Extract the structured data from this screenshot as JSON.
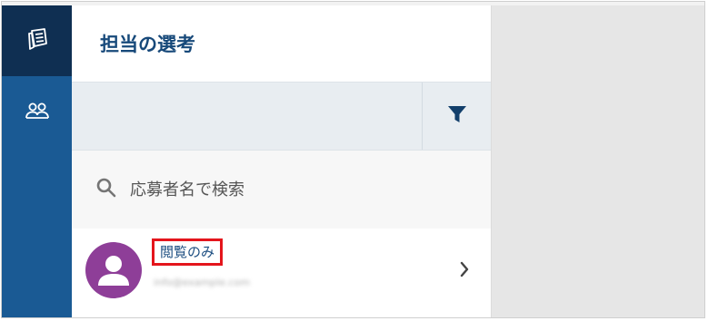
{
  "sidebar": {
    "items": [
      {
        "name": "selections",
        "icon": "document-stack-icon",
        "active": true
      },
      {
        "name": "users",
        "icon": "users-icon",
        "active": false
      }
    ],
    "colors": {
      "background": "#1a5a94",
      "active": "#0f2f52"
    }
  },
  "panel": {
    "title": "担当の選考",
    "filter": {
      "icon": "filter-icon"
    },
    "search": {
      "placeholder": "応募者名で検索",
      "value": ""
    },
    "applicants": [
      {
        "name": "閲覧のみ",
        "email": "info@example.com",
        "avatar": "person-icon",
        "avatar_color": "#8e3e98"
      }
    ]
  }
}
